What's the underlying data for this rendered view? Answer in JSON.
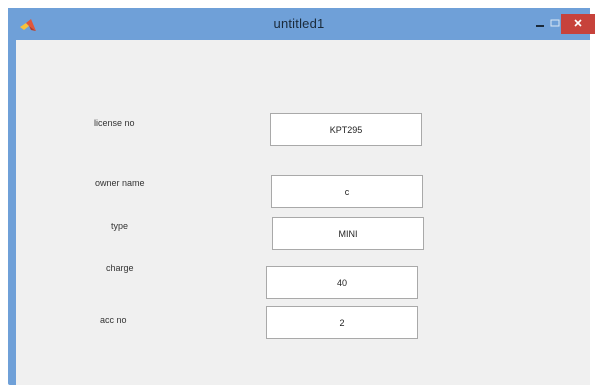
{
  "window": {
    "title": "untitled1",
    "accent_color": "#6fa0d8",
    "close_color": "#c7423b"
  },
  "icons": {
    "app": "matlab-logo-icon",
    "minimize": "minimize-icon",
    "maximize": "maximize-icon",
    "close": "close-icon"
  },
  "form": {
    "license_label": "license no",
    "license_value": "KPT295",
    "owner_label": "owner name",
    "owner_value": "c",
    "type_label": "type",
    "type_value": "MINI",
    "charge_label": "charge",
    "charge_value": "40",
    "acc_label": "acc no",
    "acc_value": "2"
  }
}
